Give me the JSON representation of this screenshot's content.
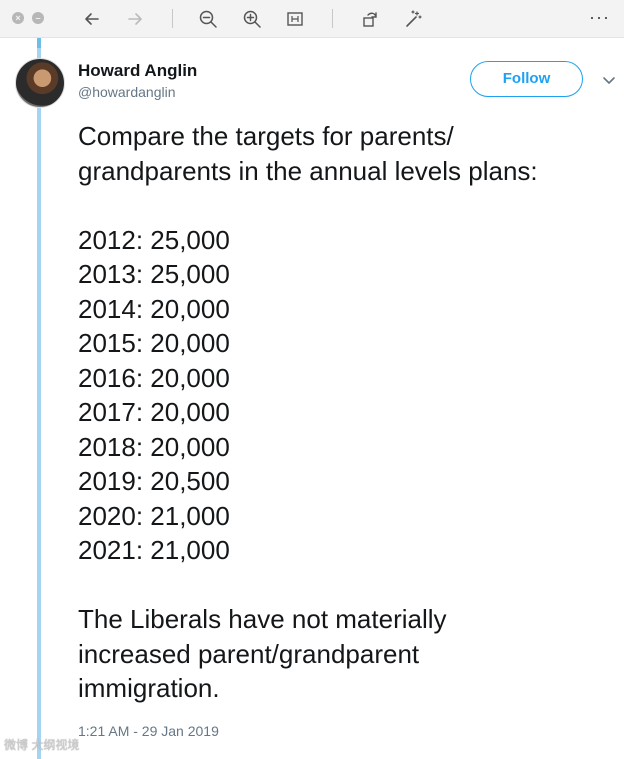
{
  "toolbar": {
    "icons": [
      "close-icon",
      "minimize-icon",
      "back-arrow-icon",
      "forward-arrow-icon",
      "zoom-out-icon",
      "zoom-in-icon",
      "fit-icon",
      "rotate-icon",
      "magic-wand-icon",
      "more-icon"
    ],
    "more_label": "···"
  },
  "tweet": {
    "author_name": "Howard Anglin",
    "author_handle": "@howardanglin",
    "follow_label": "Follow",
    "intro_lines": [
      "Compare the targets for parents/",
      "grandparents in the annual levels plans:"
    ],
    "targets": [
      "2012: 25,000",
      "2013: 25,000",
      "2014: 20,000",
      "2015: 20,000",
      "2016: 20,000",
      "2017: 20,000",
      "2018: 20,000",
      "2019: 20,500",
      "2020: 21,000",
      "2021: 21,000"
    ],
    "conclusion_lines": [
      "The Liberals have not materially",
      "increased parent/grandparent",
      "immigration."
    ],
    "timestamp": "1:21 AM - 29 Jan 2019"
  },
  "watermark": "微博 大纲视境",
  "colors": {
    "accent": "#1da1f2",
    "thread_line": "#a4d4f0",
    "secondary_text": "#657786"
  }
}
